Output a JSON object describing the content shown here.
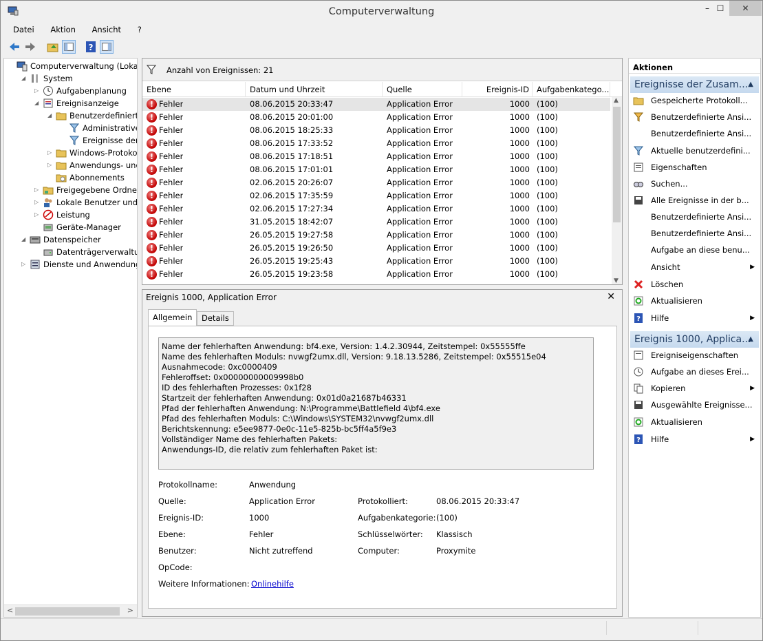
{
  "window": {
    "title": "Computerverwaltung",
    "min": "–",
    "max": "☐",
    "close": "✕"
  },
  "menu": [
    "Datei",
    "Aktion",
    "Ansicht",
    "?"
  ],
  "toolbar": [
    "back-icon",
    "forward-icon",
    "up-folder-icon",
    "show-tree-icon",
    "help-icon",
    "properties-icon"
  ],
  "tree": [
    {
      "label": "Computerverwaltung (Lokal)",
      "level": 0,
      "arrow": "",
      "icon": "computer-icon"
    },
    {
      "label": "System",
      "level": 1,
      "arrow": "◢",
      "icon": "tools-icon"
    },
    {
      "label": "Aufgabenplanung",
      "level": 2,
      "arrow": "▷",
      "icon": "clock-icon"
    },
    {
      "label": "Ereignisanzeige",
      "level": 2,
      "arrow": "◢",
      "icon": "event-viewer-icon"
    },
    {
      "label": "Benutzerdefinierte A",
      "level": 3,
      "arrow": "◢",
      "icon": "folder-icon"
    },
    {
      "label": "Administrative E",
      "level": 4,
      "arrow": "",
      "icon": "filter-icon"
    },
    {
      "label": "Ereignisse der Zu",
      "level": 4,
      "arrow": "",
      "icon": "filter-icon"
    },
    {
      "label": "Windows-Protokolle",
      "level": 3,
      "arrow": "▷",
      "icon": "folder-icon"
    },
    {
      "label": "Anwendungs- und D",
      "level": 3,
      "arrow": "▷",
      "icon": "folder-icon"
    },
    {
      "label": "Abonnements",
      "level": 3,
      "arrow": "",
      "icon": "subscription-icon"
    },
    {
      "label": "Freigegebene Ordner",
      "level": 2,
      "arrow": "▷",
      "icon": "shared-folder-icon"
    },
    {
      "label": "Lokale Benutzer und Gru",
      "level": 2,
      "arrow": "▷",
      "icon": "users-icon"
    },
    {
      "label": "Leistung",
      "level": 2,
      "arrow": "▷",
      "icon": "performance-icon"
    },
    {
      "label": "Geräte-Manager",
      "level": 2,
      "arrow": "",
      "icon": "device-manager-icon"
    },
    {
      "label": "Datenspeicher",
      "level": 1,
      "arrow": "◢",
      "icon": "storage-icon"
    },
    {
      "label": "Datenträgerverwaltung",
      "level": 2,
      "arrow": "",
      "icon": "disk-icon"
    },
    {
      "label": "Dienste und Anwendungen",
      "level": 1,
      "arrow": "▷",
      "icon": "services-icon"
    }
  ],
  "events": {
    "count_label": "Anzahl von Ereignissen: 21",
    "columns": [
      "Ebene",
      "Datum und Uhrzeit",
      "Quelle",
      "Ereignis-ID",
      "Aufgabenkatego..."
    ],
    "rows": [
      {
        "level": "Fehler",
        "date": "08.06.2015 20:33:47",
        "source": "Application Error",
        "id": "1000",
        "task": "(100)"
      },
      {
        "level": "Fehler",
        "date": "08.06.2015 20:01:00",
        "source": "Application Error",
        "id": "1000",
        "task": "(100)"
      },
      {
        "level": "Fehler",
        "date": "08.06.2015 18:25:33",
        "source": "Application Error",
        "id": "1000",
        "task": "(100)"
      },
      {
        "level": "Fehler",
        "date": "08.06.2015 17:33:52",
        "source": "Application Error",
        "id": "1000",
        "task": "(100)"
      },
      {
        "level": "Fehler",
        "date": "08.06.2015 17:18:51",
        "source": "Application Error",
        "id": "1000",
        "task": "(100)"
      },
      {
        "level": "Fehler",
        "date": "08.06.2015 17:01:01",
        "source": "Application Error",
        "id": "1000",
        "task": "(100)"
      },
      {
        "level": "Fehler",
        "date": "02.06.2015 20:26:07",
        "source": "Application Error",
        "id": "1000",
        "task": "(100)"
      },
      {
        "level": "Fehler",
        "date": "02.06.2015 17:35:59",
        "source": "Application Error",
        "id": "1000",
        "task": "(100)"
      },
      {
        "level": "Fehler",
        "date": "02.06.2015 17:27:34",
        "source": "Application Error",
        "id": "1000",
        "task": "(100)"
      },
      {
        "level": "Fehler",
        "date": "31.05.2015 18:42:07",
        "source": "Application Error",
        "id": "1000",
        "task": "(100)"
      },
      {
        "level": "Fehler",
        "date": "26.05.2015 19:27:58",
        "source": "Application Error",
        "id": "1000",
        "task": "(100)"
      },
      {
        "level": "Fehler",
        "date": "26.05.2015 19:26:50",
        "source": "Application Error",
        "id": "1000",
        "task": "(100)"
      },
      {
        "level": "Fehler",
        "date": "26.05.2015 19:25:43",
        "source": "Application Error",
        "id": "1000",
        "task": "(100)"
      },
      {
        "level": "Fehler",
        "date": "26.05.2015 19:23:58",
        "source": "Application Error",
        "id": "1000",
        "task": "(100)"
      }
    ]
  },
  "detail": {
    "title": "Ereignis 1000, Application Error",
    "close": "✕",
    "tabs": [
      "Allgemein",
      "Details"
    ],
    "description": [
      "Name der fehlerhaften Anwendung: bf4.exe, Version: 1.4.2.30944, Zeitstempel: 0x55555ffe",
      "Name des fehlerhaften Moduls: nvwgf2umx.dll, Version: 9.18.13.5286, Zeitstempel: 0x55515e04",
      "Ausnahmecode: 0xc0000409",
      "Fehleroffset: 0x00000000009998b0",
      "ID des fehlerhaften Prozesses: 0x1f28",
      "Startzeit der fehlerhaften Anwendung: 0x01d0a21687b46331",
      "Pfad der fehlerhaften Anwendung: N:\\Programme\\Battlefield 4\\bf4.exe",
      "Pfad des fehlerhaften Moduls: C:\\Windows\\SYSTEM32\\nvwgf2umx.dll",
      "Berichtskennung: e5ee9877-0e0c-11e5-825b-bc5ff4a5f9e3",
      "Vollständiger Name des fehlerhaften Pakets:",
      "Anwendungs-ID, die relativ zum fehlerhaften Paket ist:"
    ],
    "fields": {
      "protokollname_label": "Protokollname:",
      "protokollname": "Anwendung",
      "quelle_label": "Quelle:",
      "quelle": "Application Error",
      "protokolliert_label": "Protokolliert:",
      "protokolliert": "08.06.2015 20:33:47",
      "id_label": "Ereignis-ID:",
      "id": "1000",
      "aufgabe_label": "Aufgabenkategorie:",
      "aufgabe": "(100)",
      "ebene_label": "Ebene:",
      "ebene": "Fehler",
      "schluessel_label": "Schlüsselwörter:",
      "schluessel": "Klassisch",
      "benutzer_label": "Benutzer:",
      "benutzer": "Nicht zutreffend",
      "computer_label": "Computer:",
      "computer": "Proxymite",
      "opcode_label": "OpCode:",
      "weitere_label": "Weitere Informationen:",
      "weitere_link": "Onlinehilfe"
    }
  },
  "actions": {
    "header": "Aktionen",
    "section1": "Ereignisse der Zusam...",
    "items1": [
      {
        "label": "Gespeicherte Protokoll...",
        "icon": "open-log-icon"
      },
      {
        "label": "Benutzerdefinierte Ansi...",
        "icon": "filter-create-icon"
      },
      {
        "label": "Benutzerdefinierte Ansi...",
        "icon": "none"
      },
      {
        "label": "Aktuelle benutzerdefini...",
        "icon": "filter-icon"
      },
      {
        "label": "Eigenschaften",
        "icon": "properties-icon"
      },
      {
        "label": "Suchen...",
        "icon": "find-icon"
      },
      {
        "label": "Alle Ereignisse in der b...",
        "icon": "save-icon"
      },
      {
        "label": "Benutzerdefinierte Ansi...",
        "icon": "none"
      },
      {
        "label": "Benutzerdefinierte Ansi...",
        "icon": "none"
      },
      {
        "label": "Aufgabe an diese benu...",
        "icon": "none"
      },
      {
        "label": "Ansicht",
        "icon": "none",
        "sub": true
      },
      {
        "label": "Löschen",
        "icon": "delete-icon"
      },
      {
        "label": "Aktualisieren",
        "icon": "refresh-icon"
      },
      {
        "label": "Hilfe",
        "icon": "help-icon",
        "sub": true
      }
    ],
    "section2": "Ereignis 1000, Applica...",
    "items2": [
      {
        "label": "Ereigniseigenschaften",
        "icon": "event-properties-icon"
      },
      {
        "label": "Aufgabe an dieses Erei...",
        "icon": "task-icon"
      },
      {
        "label": "Kopieren",
        "icon": "copy-icon",
        "sub": true
      },
      {
        "label": "Ausgewählte Ereignisse...",
        "icon": "save-icon"
      },
      {
        "label": "Aktualisieren",
        "icon": "refresh-icon"
      },
      {
        "label": "Hilfe",
        "icon": "help-icon",
        "sub": true
      }
    ]
  }
}
